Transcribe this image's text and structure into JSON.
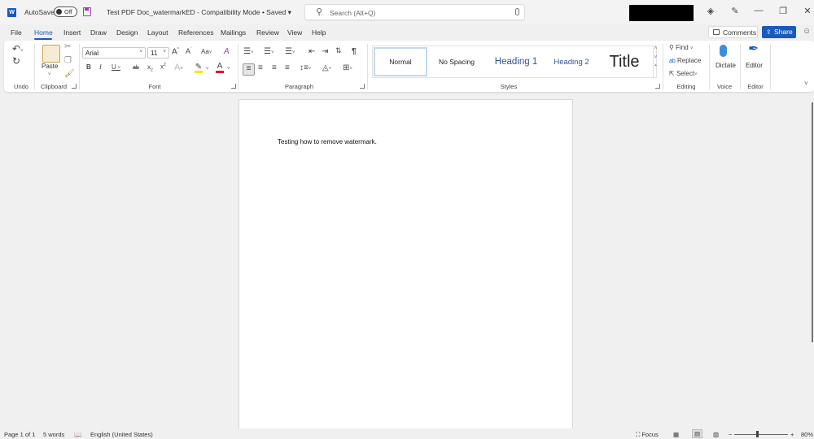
{
  "titlebar": {
    "app_icon": "word-icon",
    "app_letter": "W",
    "autosave_label": "AutoSave",
    "autosave_state": "Off",
    "doc_title": "Test PDF Doc_watermarkED  -  Compatibility Mode • Saved  ▾",
    "search_placeholder": "Search (Alt+Q)",
    "icons": [
      "diamond-icon",
      "pen-icon",
      "minimize-icon",
      "restore-icon",
      "close-icon"
    ],
    "minimize": "—",
    "restore": "❐",
    "close": "✕",
    "diamond": "◈",
    "pen": "✎"
  },
  "tabs": [
    "File",
    "Home",
    "Insert",
    "Draw",
    "Design",
    "Layout",
    "References",
    "Mailings",
    "Review",
    "View",
    "Help"
  ],
  "active_tab": "Home",
  "comments_label": "Comments",
  "share_label": "Share",
  "ribbon": {
    "groups": {
      "undo": "Undo",
      "clipboard": "Clipboard",
      "font": "Font",
      "paragraph": "Paragraph",
      "styles": "Styles",
      "editing": "Editing",
      "voice": "Voice",
      "editor": "Editor"
    },
    "paste_label": "Paste",
    "font_name": "Arial",
    "font_size": "11",
    "styles": [
      "Normal",
      "No Spacing",
      "Heading 1",
      "Heading 2",
      "Title"
    ],
    "selected_style": "Normal",
    "find_label": "Find",
    "replace_label": "Replace",
    "select_label": "Select",
    "dictate_label": "Dictate",
    "editor_label": "Editor",
    "colors": {
      "highlight": "#f5e800",
      "font_color": "#e81123",
      "accent": "#185abd",
      "heading": "#2f5496"
    }
  },
  "document": {
    "text": "Testing how to remove watermark."
  },
  "statusbar": {
    "page": "Page 1 of 1",
    "words": "5 words",
    "language": "English (United States)",
    "focus": "Focus",
    "zoom": "80%",
    "zoom_minus": "−",
    "zoom_plus": "+"
  }
}
